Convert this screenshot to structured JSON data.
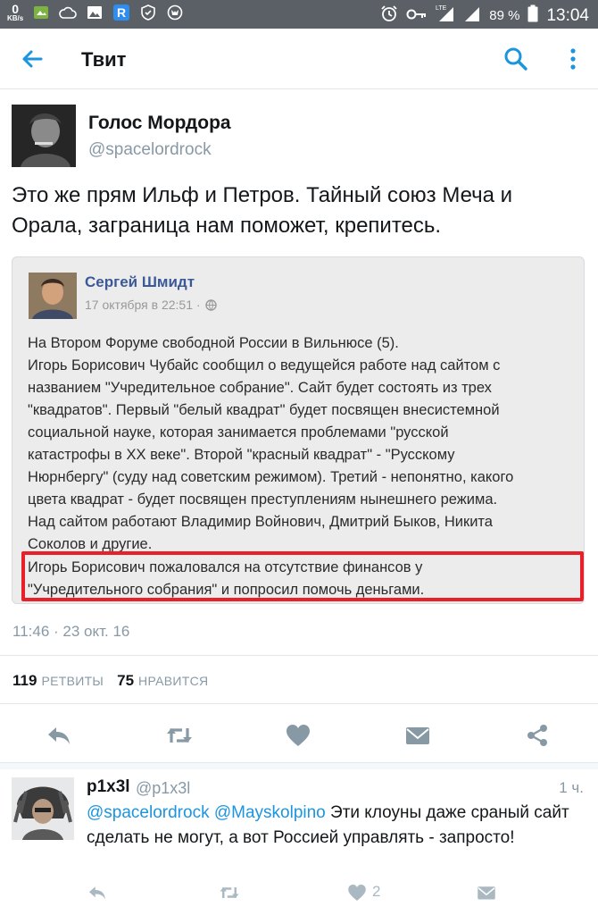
{
  "status_bar": {
    "net_speed": "0",
    "net_unit": "KB/s",
    "battery_percent": "89 %",
    "time": "13:04",
    "network": "LTE",
    "icons": [
      "image-icon",
      "cloud-icon",
      "gallery-icon",
      "r-app-icon",
      "shield-icon",
      "fox-icon",
      "alarm-icon",
      "key-icon",
      "signal-icon",
      "battery-icon"
    ]
  },
  "app_bar": {
    "title": "Твит",
    "icons": [
      "back-arrow-icon",
      "search-icon",
      "more-vertical-icon"
    ]
  },
  "tweet": {
    "author_name": "Голос Мордора",
    "author_handle": "@spacelordrock",
    "text": "Это же прям Ильф и Петров. Тайный союз Меча и Орала, заграница нам поможет, крепитесь.",
    "timestamp": "11:46 · 23 окт. 16",
    "retweets_count": "119",
    "retweets_label": "РЕТВИТЫ",
    "likes_count": "75",
    "likes_label": "НРАВИТСЯ"
  },
  "embedded_post": {
    "author": "Сергей Шмидт",
    "date": "17 октября в 22:51 ·",
    "body_lines": [
      "На Втором Форуме свободной России в Вильнюсе (5).",
      "Игорь Борисович Чубайс сообщил о ведущейся работе над сайтом с",
      "названием \"Учредительное собрание\". Сайт будет состоять из трех",
      "\"квадратов\". Первый \"белый квадрат\" будет посвящен внесистемной",
      "социальной науке, которая занимается проблемами \"русской",
      "катастрофы в XX веке\". Второй \"красный квадрат\" - \"Русскому",
      "Нюрнбергу\" (суду над советским режимом). Третий - непонятно, какого",
      "цвета квадрат - будет посвящен преступлениям нынешнего режима.",
      "Над сайтом работают Владимир Войнович, Дмитрий Быков, Никита",
      "Соколов и другие."
    ],
    "highlight_lines": [
      "Игорь Борисович пожаловался на отсутствие финансов у",
      "\"Учредительного собрания\" и попросил помочь деньгами."
    ],
    "highlight_color": "#e8202a"
  },
  "reply": {
    "author_name": "p1x3l",
    "author_handle": "@p1x3l",
    "time": "1 ч.",
    "mention_1": "@spacelordrock",
    "mention_2": "@Mayskolpino",
    "text_rest": " Эти клоуны даже сраный сайт сделать не могут, а вот Россией управлять - запросто!",
    "likes_count": "2"
  },
  "colors": {
    "accent": "#1b95e0",
    "muted": "#8899a6",
    "status_bar": "#5b6066",
    "fb_link": "#3b5998"
  }
}
